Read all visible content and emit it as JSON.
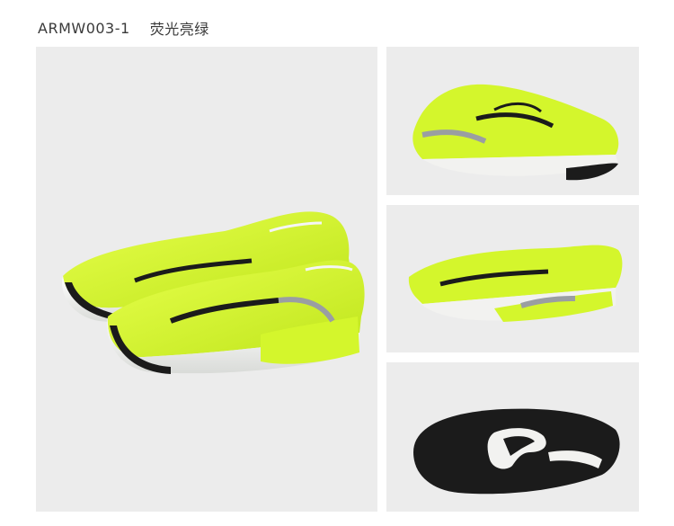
{
  "header": {
    "sku": "ARMW003-1",
    "color_name": "荧光亮绿"
  },
  "palette": {
    "panel_bg": "#ececec",
    "upper": "#d4f62c",
    "midsole": "#f2f2f0",
    "outsole": "#1b1b1b",
    "accent": "#9a9ea2"
  }
}
